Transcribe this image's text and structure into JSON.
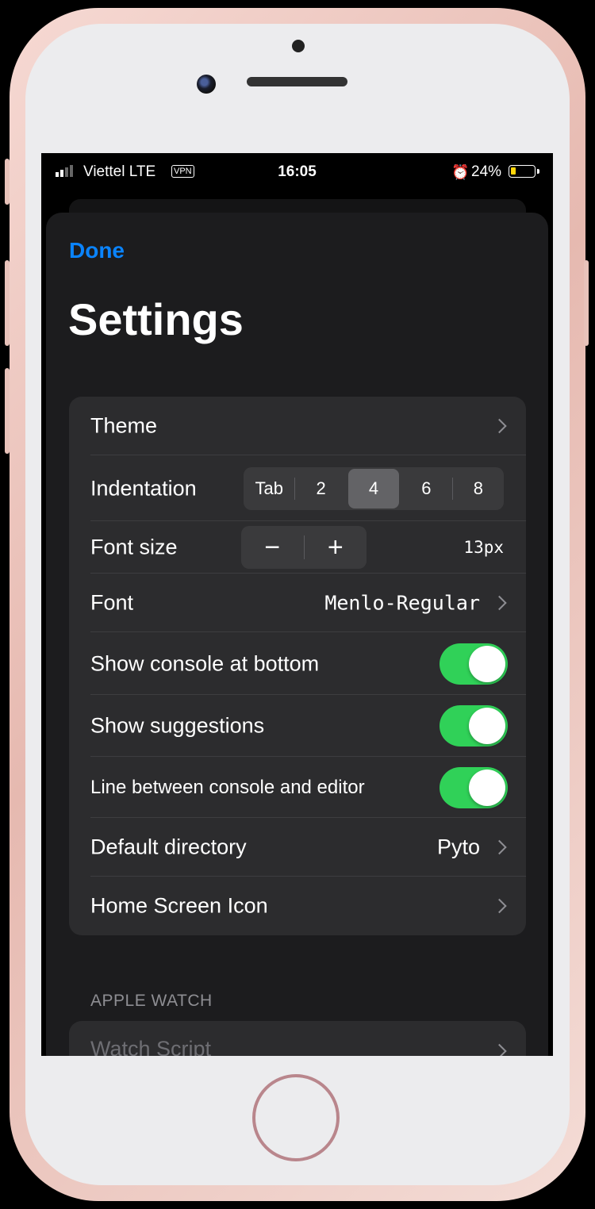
{
  "status_bar": {
    "carrier": "Viettel  LTE",
    "vpn": "VPN",
    "time": "16:05",
    "battery_percent": "24%",
    "battery_level": 0.24,
    "battery_color": "#ffd60a"
  },
  "header": {
    "done_label": "Done",
    "title": "Settings"
  },
  "settings": {
    "theme_label": "Theme",
    "indentation": {
      "label": "Indentation",
      "options": [
        "Tab",
        "2",
        "4",
        "6",
        "8"
      ],
      "selected": "4"
    },
    "font_size": {
      "label": "Font size",
      "minus": "−",
      "plus": "+",
      "value": "13px"
    },
    "font": {
      "label": "Font",
      "value": "Menlo-Regular"
    },
    "show_console_at_bottom": {
      "label": "Show console at bottom",
      "on": true
    },
    "show_suggestions": {
      "label": "Show suggestions",
      "on": true
    },
    "line_between_console_and_editor": {
      "label": "Line between console and editor",
      "on": true
    },
    "default_directory": {
      "label": "Default directory",
      "value": "Pyto"
    },
    "home_screen_icon_label": "Home Screen Icon"
  },
  "apple_watch": {
    "section_title": "APPLE WATCH",
    "watch_script_label": "Watch Script"
  },
  "colors": {
    "accent": "#0a84ff",
    "toggle_on": "#30d158",
    "background": "#1c1c1e",
    "cell": "#2c2c2e"
  }
}
